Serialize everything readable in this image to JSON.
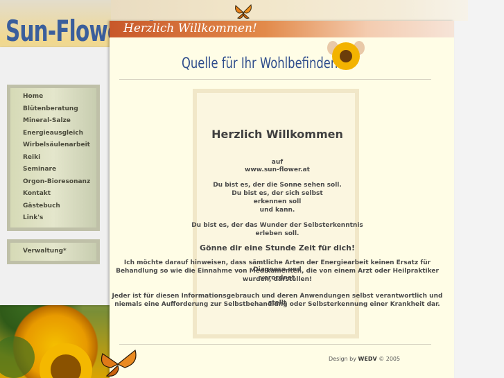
{
  "logo": "Sun-Flower.at",
  "banner": "Herzlich Willkommen!",
  "tagline": "Quelle für Ihr Wohlbefinden",
  "menu": {
    "items": [
      "Home",
      "Blütenberatung",
      "Mineral-Salze",
      "Energieausgleich",
      "Wirbelsäulenarbeit",
      "Reiki",
      "Seminare",
      "Orgon-Bioresonanz",
      "Kontakt",
      "Gästebuch",
      "Link's"
    ],
    "admin": "Verwaltung*"
  },
  "content": {
    "heading": "Herzlich Willkommen",
    "line_auf": "auf",
    "line_url": "www.sun-flower.at",
    "p1_1": "Du bist es, der die Sonne sehen soll.",
    "p1_2": "Du bist es, der sich selbst",
    "p1_3": "erkennen soll",
    "p1_4": "und kann.",
    "p2_1": "Du bist es, der das Wunder der Selbsterkenntnis",
    "p2_2": "erleben soll.",
    "subheading": "Gönne dir eine Stunde Zeit für dich!",
    "note1_1": "Ich möchte darauf hinweisen, dass sämtliche Arten der Energiearbeit keinen Ersatz für Diagnose und",
    "note1_2": "Behandlung so wie die Einnahme von Medikamenten, die von einem Arzt oder Heilpraktiker verordnet",
    "note1_3": "wurden, darstellen!",
    "note2_1": "Jeder ist für diesen Informationsgebrauch und deren Anwendungen selbst verantwortlich und stellt",
    "note2_2": "niemals eine Aufforderung zur Selbstbehandlung oder Selbsterkennung einer Krankheit dar."
  },
  "footer": {
    "prefix": "Design by",
    "brand": "WEDV",
    "suffix": "© 2005"
  },
  "colors": {
    "banner": "#c8582a",
    "logo": "#3a5e9c",
    "page": "#fffde6"
  }
}
